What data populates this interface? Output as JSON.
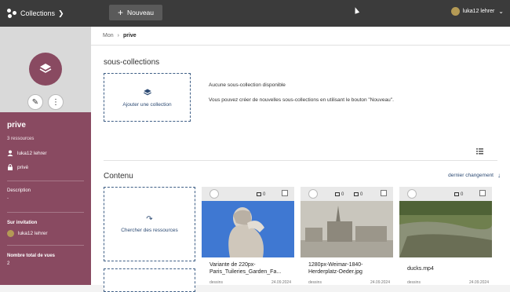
{
  "topbar": {
    "app_title": "Collections",
    "new_button": "Nouveau",
    "user_name": "luka12 lehrer"
  },
  "sidebar": {
    "collection_name": "prive",
    "resource_count": "3 ressources",
    "owner": "luka12 lehrer",
    "visibility": "privé",
    "description_label": "Description",
    "description_value": "-",
    "invitation_label": "Sur invitation",
    "invitation_user": "luka12 lehrer",
    "views_label": "Nombre total de vues",
    "views_value": "2",
    "accent_color": "#894a61"
  },
  "breadcrumb": {
    "root": "Mon",
    "current": "prive"
  },
  "subcollections": {
    "heading": "sous-collections",
    "add_label": "Ajouter une collection",
    "empty_title": "Aucune sous-collection disponible",
    "empty_hint": "Vous pouvez créer de nouvelles sous-collections en utilisant le bouton \"Nouveau\"."
  },
  "content": {
    "heading": "Contenu",
    "sort_label": "dernier changement",
    "search_label": "Chercher des ressources",
    "resources": [
      {
        "title": "Variante de 220px-Paris_Tuileries_Garden_Fa...",
        "badge": "0",
        "badge2": "",
        "meta_left": "dessins",
        "date": "24.09.2024"
      },
      {
        "title": "1280px-Weimar-1840-Herderplatz-Oeder.jpg",
        "badge": "0",
        "badge2": "0",
        "meta_left": "dessins",
        "date": "24.09.2024"
      },
      {
        "title": "ducks.mp4",
        "badge": "0",
        "badge2": "",
        "meta_left": "dessins",
        "date": "24.09.2024"
      }
    ]
  }
}
